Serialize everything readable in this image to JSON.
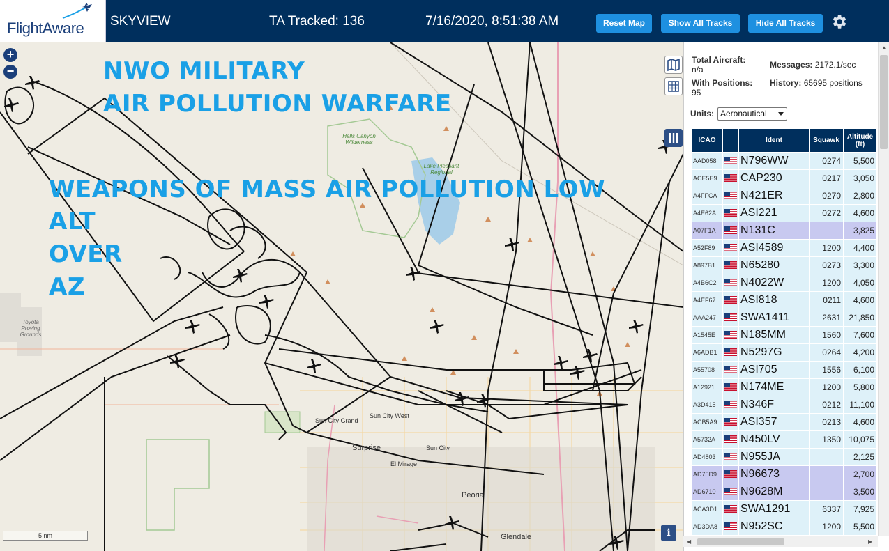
{
  "header": {
    "logo_text": "FlightAware",
    "app_name": "SKYVIEW",
    "tracked": "TA Tracked: 136",
    "datetime": "7/16/2020, 8:51:38 AM",
    "buttons": {
      "reset": "Reset Map",
      "show": "Show All Tracks",
      "hide": "Hide All Tracks"
    }
  },
  "overlay": {
    "line1": "NWO MILITARY",
    "line2": "AIR POLLUTION WARFARE",
    "line3": "WEAPONS OF MASS AIR POLLUTION LOW",
    "line4": "ALT",
    "line5": "OVER",
    "line6": "AZ"
  },
  "map": {
    "scale": "5 nm",
    "places": {
      "hells_canyon": "Hells Canyon Wilderness",
      "lake_pleasant": "Lake Pleasant Regional",
      "toyota": "Toyota Proving Grounds",
      "sun_city_grand": "Sun City Grand",
      "sun_city_west": "Sun City West",
      "surprise": "Surprise",
      "sun_city": "Sun City",
      "el_mirage": "El Mirage",
      "peoria": "Peoria",
      "glendale": "Glendale"
    },
    "info_label": "i"
  },
  "sidebar": {
    "stats": {
      "total_label": "Total Aircraft:",
      "total_value": "n/a",
      "messages_label": "Messages:",
      "messages_value": "2172.1/sec",
      "positions_label": "With Positions:",
      "positions_value": "95",
      "history_label": "History:",
      "history_value": "65695 positions"
    },
    "units_label": "Units:",
    "units_value": "Aeronautical",
    "columns": [
      "ICAO",
      "Ident",
      "Squawk",
      "Altitude (ft)"
    ],
    "rows": [
      {
        "icao": "AAD058",
        "ident": "N796WW",
        "squawk": "0274",
        "alt": "5,500",
        "sel": false
      },
      {
        "icao": "ACE5E9",
        "ident": "CAP230",
        "squawk": "0217",
        "alt": "3,050",
        "sel": false
      },
      {
        "icao": "A4FFCA",
        "ident": "N421ER",
        "squawk": "0270",
        "alt": "2,800",
        "sel": false
      },
      {
        "icao": "A4E62A",
        "ident": "ASI221",
        "squawk": "0272",
        "alt": "4,600",
        "sel": false
      },
      {
        "icao": "A07F1A",
        "ident": "N131C",
        "squawk": "",
        "alt": "3,825",
        "sel": true
      },
      {
        "icao": "A52F89",
        "ident": "ASI4589",
        "squawk": "1200",
        "alt": "4,400",
        "sel": false
      },
      {
        "icao": "A897B1",
        "ident": "N65280",
        "squawk": "0273",
        "alt": "3,300",
        "sel": false
      },
      {
        "icao": "A4B6C2",
        "ident": "N4022W",
        "squawk": "1200",
        "alt": "4,050",
        "sel": false
      },
      {
        "icao": "A4EF67",
        "ident": "ASI818",
        "squawk": "0211",
        "alt": "4,600",
        "sel": false
      },
      {
        "icao": "AAA247",
        "ident": "SWA1411",
        "squawk": "2631",
        "alt": "21,850",
        "sel": false
      },
      {
        "icao": "A1545E",
        "ident": "N185MM",
        "squawk": "1560",
        "alt": "7,600",
        "sel": false
      },
      {
        "icao": "A6ADB1",
        "ident": "N5297G",
        "squawk": "0264",
        "alt": "4,200",
        "sel": false
      },
      {
        "icao": "A55708",
        "ident": "ASI705",
        "squawk": "1556",
        "alt": "6,100",
        "sel": false
      },
      {
        "icao": "A12921",
        "ident": "N174ME",
        "squawk": "1200",
        "alt": "5,800",
        "sel": false
      },
      {
        "icao": "A3D415",
        "ident": "N346F",
        "squawk": "0212",
        "alt": "11,100",
        "sel": false
      },
      {
        "icao": "ACB5A9",
        "ident": "ASI357",
        "squawk": "0213",
        "alt": "4,600",
        "sel": false
      },
      {
        "icao": "A5732A",
        "ident": "N450LV",
        "squawk": "1350",
        "alt": "10,075",
        "sel": false
      },
      {
        "icao": "AD4803",
        "ident": "N955JA",
        "squawk": "",
        "alt": "2,125",
        "sel": false
      },
      {
        "icao": "AD75D9",
        "ident": "N96673",
        "squawk": "",
        "alt": "2,700",
        "sel": true
      },
      {
        "icao": "AD6710",
        "ident": "N9628M",
        "squawk": "",
        "alt": "3,500",
        "sel": true
      },
      {
        "icao": "ACA3D1",
        "ident": "SWA1291",
        "squawk": "6337",
        "alt": "7,925",
        "sel": false
      },
      {
        "icao": "AD3DA8",
        "ident": "N952SC",
        "squawk": "1200",
        "alt": "5,500",
        "sel": false
      }
    ]
  },
  "colors": {
    "header_bg": "#002f5d",
    "button_bg": "#1e90e0",
    "overlay_text": "#1aa0e6",
    "row_bg": "#def1f9",
    "row_selected_bg": "#c8c9f0",
    "map_bg": "#efece3"
  }
}
